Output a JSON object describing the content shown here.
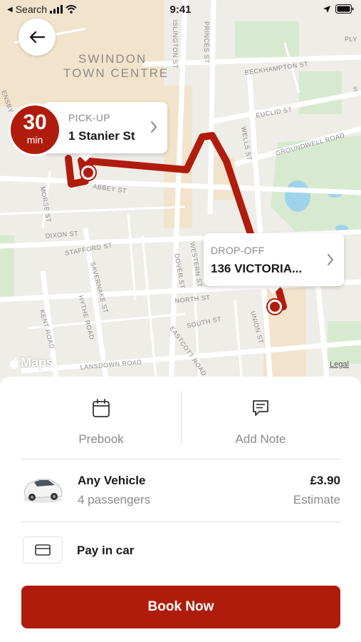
{
  "status_bar": {
    "back_app": "Search",
    "time": "9:41"
  },
  "map": {
    "area_label_line1": "SWINDON",
    "area_label_line2": "TOWN CENTRE",
    "streets": [
      "ISLINGTON ST",
      "PRINCES ST",
      "BECKHAMPTON ST",
      "EUCLID ST",
      "WELLS ST",
      "GROUNDWELL ROAD",
      "ABBEY ST",
      "MORSE ST",
      "DIXON ST",
      "STAFFORD ST",
      "SAVERNAKE ST",
      "WESTERN ST",
      "DOVER ST",
      "NORTH ST",
      "SOUTH ST",
      "UNION ST",
      "HYTHE ROAD",
      "KENT ROAD",
      "EASTCOTT ROAD",
      "LANSDOWN ROAD",
      "PLY",
      "S",
      "ENSBY"
    ],
    "maps_label": "Maps",
    "legal_label": "Legal",
    "route_color": "#b01c0c"
  },
  "pickup": {
    "eta_value": "30",
    "eta_unit": "min",
    "label": "PICK-UP",
    "address": "1 Stanier St"
  },
  "dropoff": {
    "label": "DROP-OFF",
    "address": "136 VICTORIA..."
  },
  "actions": {
    "prebook_label": "Prebook",
    "add_note_label": "Add Note"
  },
  "vehicle": {
    "name": "Any Vehicle",
    "passengers": "4 passengers",
    "price": "£3.90",
    "price_note": "Estimate"
  },
  "payment": {
    "label": "Pay in car"
  },
  "book_button": {
    "label": "Book Now",
    "color": "#b01c0c"
  }
}
